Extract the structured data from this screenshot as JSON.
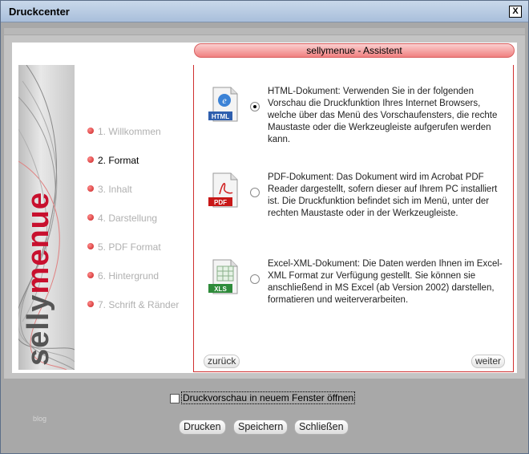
{
  "window": {
    "title": "Druckcenter",
    "close_label": "X"
  },
  "header": {
    "title": "sellymenue - Assistent"
  },
  "logo": {
    "part1": "selly",
    "part2": "menue"
  },
  "steps": [
    {
      "label": "1. Willkommen",
      "active": false
    },
    {
      "label": "2. Format",
      "active": true
    },
    {
      "label": "3. Inhalt",
      "active": false
    },
    {
      "label": "4. Darstellung",
      "active": false
    },
    {
      "label": "5. PDF Format",
      "active": false
    },
    {
      "label": "6. Hintergrund",
      "active": false
    },
    {
      "label": "7. Schrift & Ränder",
      "active": false
    }
  ],
  "options": {
    "html": {
      "badge": "HTML",
      "icon": "html-document-icon",
      "checked": true,
      "text": "HTML-Dokument: Verwenden Sie in der folgenden Vorschau die Druckfunktion Ihres Internet Browsers, welche über das Menü des Vorschaufensters, die rechte Maustaste oder die Werkzeugleiste aufgerufen werden kann."
    },
    "pdf": {
      "badge": "PDF",
      "icon": "pdf-document-icon",
      "checked": false,
      "text": "PDF-Dokument: Das Dokument wird im Acrobat PDF Reader dargestellt, sofern dieser auf Ihrem PC installiert ist. Die Druckfunktion befindet sich im Menü, unter der rechten Maustaste oder in der Werkzeugleiste."
    },
    "xls": {
      "badge": "XLS",
      "icon": "excel-document-icon",
      "checked": false,
      "text": "Excel-XML-Dokument: Die Daten werden Ihnen im Excel-XML Format zur Verfügung gestellt. Sie können sie anschließend in MS Excel (ab Version 2002) darstellen, formatieren und weiterverarbeiten."
    }
  },
  "nav": {
    "back": "zurück",
    "next": "weiter"
  },
  "footer": {
    "preview_checkbox_label": "Druckvorschau in neuem Fenster öffnen",
    "preview_checked": false,
    "blog": "blog",
    "print": "Drucken",
    "save": "Speichern",
    "close": "Schließen"
  },
  "colors": {
    "accent": "#d03030",
    "title_bar": "#b8cbe2"
  }
}
